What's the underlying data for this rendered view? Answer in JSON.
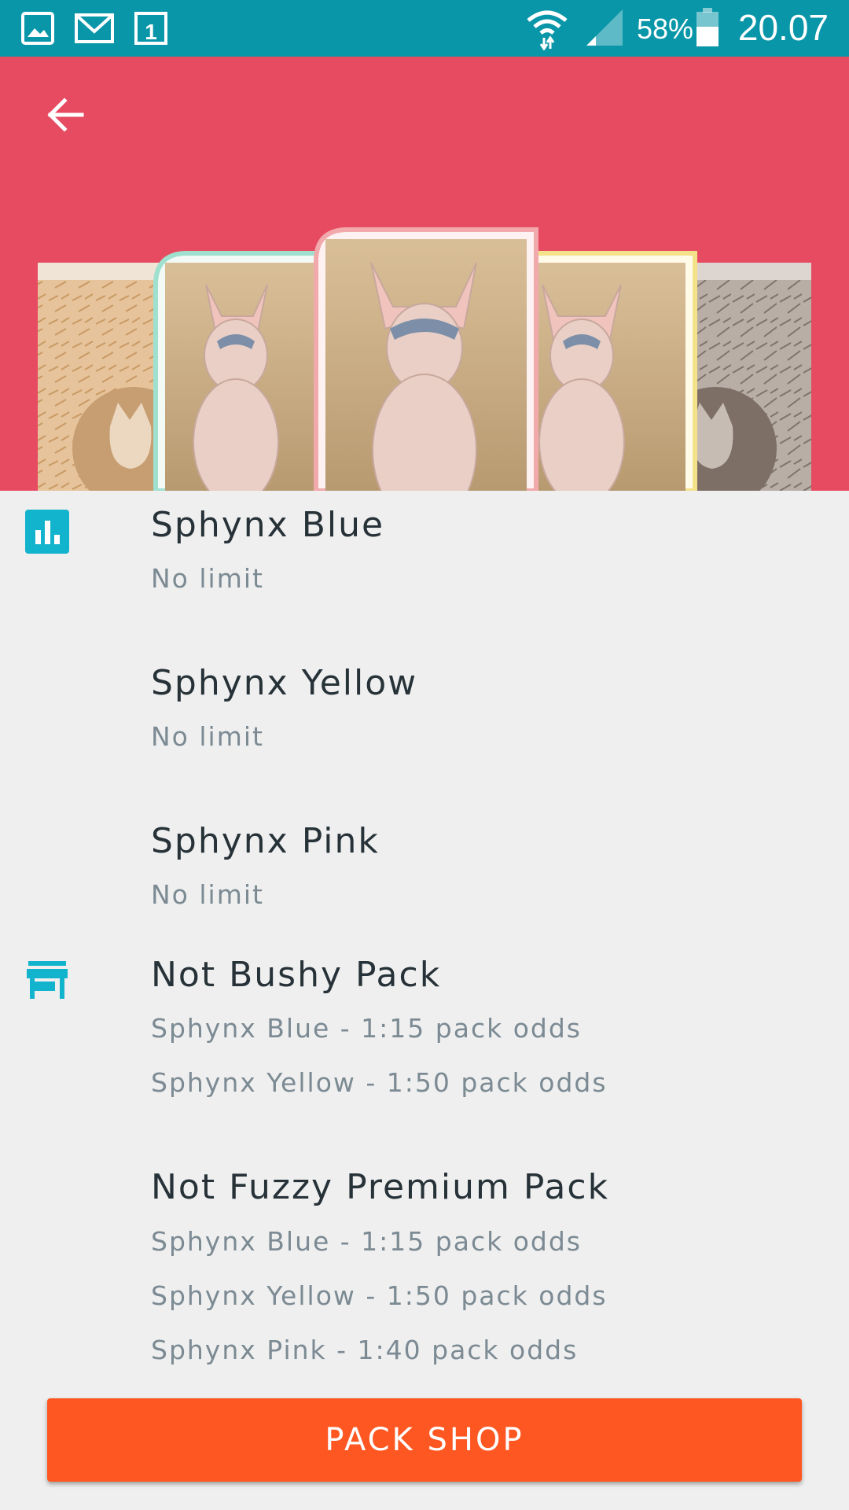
{
  "status_bar": {
    "battery_percent": "58%",
    "time": "20.07",
    "icons": [
      "gallery-icon",
      "email-icon",
      "calendar-icon",
      "wifi-icon",
      "signal-icon",
      "battery-icon"
    ]
  },
  "header": {
    "back_icon": "arrow-left-icon",
    "color": "#e64b61"
  },
  "sections": {
    "rarity": {
      "icon": "bar-chart-icon",
      "items": [
        {
          "title": "Sphynx Blue",
          "sub": "No limit"
        },
        {
          "title": "Sphynx Yellow",
          "sub": "No limit"
        },
        {
          "title": "Sphynx Pink",
          "sub": "No limit"
        }
      ]
    },
    "packs": {
      "icon": "store-icon",
      "items": [
        {
          "title": "Not Bushy Pack",
          "lines": [
            "Sphynx Blue - 1:15 pack odds",
            "Sphynx Yellow - 1:50 pack odds"
          ]
        },
        {
          "title": "Not Fuzzy Premium Pack",
          "lines": [
            "Sphynx Blue - 1:15 pack odds",
            "Sphynx Yellow - 1:50 pack odds",
            "Sphynx Pink - 1:40 pack odds"
          ]
        }
      ]
    }
  },
  "button": {
    "label": "PACK SHOP",
    "color": "#ff5722"
  },
  "colors": {
    "accent": "#12b3cc",
    "status_bar": "#0896a8"
  }
}
